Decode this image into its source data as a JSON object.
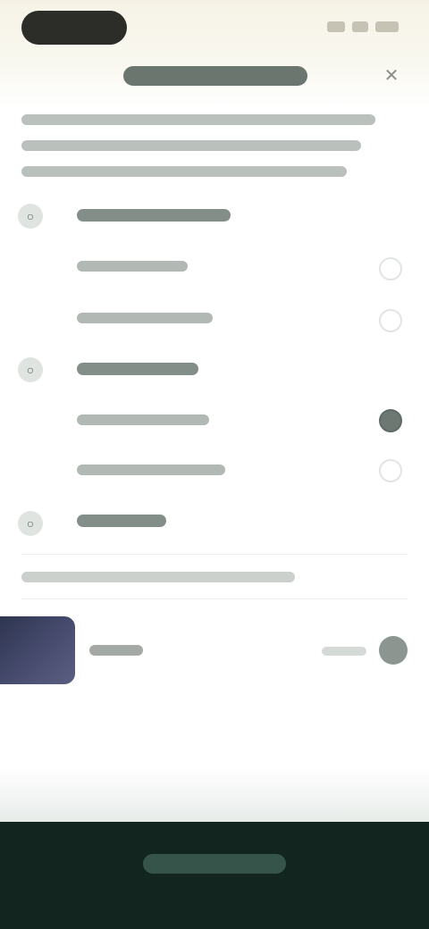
{
  "status_bar": {
    "icons": [
      "signal-icon",
      "wifi-icon",
      "battery-icon"
    ]
  },
  "header": {
    "title": "",
    "close_icon": "close-icon"
  },
  "description": {
    "text": ""
  },
  "groups": [
    {
      "icon": "circle-icon",
      "label": "",
      "options": [
        {
          "label": "",
          "selected": false
        },
        {
          "label": "",
          "selected": false
        }
      ]
    },
    {
      "icon": "circle-icon",
      "label": "",
      "options": [
        {
          "label": "",
          "selected": true
        },
        {
          "label": "",
          "selected": false
        }
      ]
    },
    {
      "icon": "circle-icon",
      "label": "",
      "options": []
    }
  ],
  "hint": {
    "text": ""
  },
  "preview": {
    "label": "",
    "meta": "",
    "action_icon": "circle-icon"
  },
  "footer": {
    "button_label": ""
  },
  "colors": {
    "footer_bg": "#12261f",
    "accent": "#3b5a4e",
    "top_bg": "#f6f3e6"
  }
}
